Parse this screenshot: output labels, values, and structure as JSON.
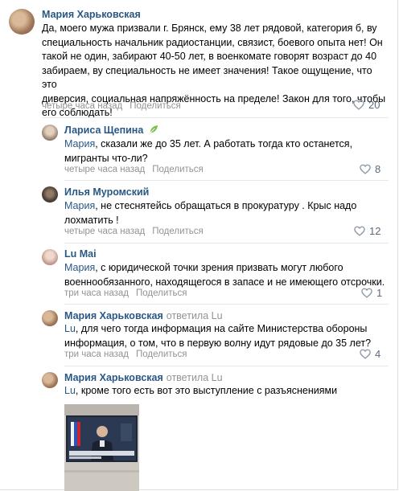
{
  "comments": [
    {
      "author": "Мария Харьковская",
      "text_lines": [
        "Да, моего мужа призвали г. Брянск, ему 38 лет рядовой, категория б, ву",
        "специальность начальник радиостанции, связист, боевого опыта нет! Он",
        "такой не один, забирают 40-50 лет, в военкомате говорят возраст до 40",
        "забираем, ву специальность не имеет значения! Такое ощущение, что это",
        "диверсия, социальная напряжённость на пределе! Закон для того, чтобы",
        "его соблюдать!"
      ],
      "time": "четыре часа назад",
      "share": "Поделиться",
      "likes": "20"
    },
    {
      "author": "Лариса Щепина",
      "badge_icon": "leaf-icon",
      "addressee": "Мария",
      "text_lines": [
        ", сказали же до 35 лет. А работать тогда кто останется,",
        "мигранты что-ли?"
      ],
      "time": "четыре часа назад",
      "share": "Поделиться",
      "likes": "8"
    },
    {
      "author": "Илья Муромский",
      "addressee": "Мария",
      "text_lines": [
        ", не стеснятейсь обращаться в прокуратуру . Крыс надо",
        "лохматить !"
      ],
      "time": "четыре часа назад",
      "share": "Поделиться",
      "likes": "12"
    },
    {
      "author": "Lu Mai",
      "addressee": "Мария",
      "text_lines": [
        ", с юридической точки зрения призвать могут любого",
        "военнообязанного, находящегося в запасе и не имеющего отсрочки."
      ],
      "time": "три часа назад",
      "share": "Поделиться",
      "likes": "1"
    },
    {
      "author": "Мария Харьковская",
      "reply_to": "ответила Lu",
      "addressee": "Lu",
      "text_lines": [
        ", для чего тогда информация на сайте Министерства обороны",
        "информация, о том, что в первую волну идут рядовые до 35 лет?"
      ],
      "time": "три часа назад",
      "share": "Поделиться",
      "likes": "4"
    },
    {
      "author": "Мария Харьковская",
      "reply_to": "ответила Lu",
      "addressee": "Lu",
      "text_lines": [
        ", кроме того есть вот это выступление с разъяснениями"
      ]
    }
  ],
  "colors": {
    "link": "#2a5885",
    "meta": "#939393",
    "likes": "#5b6b7e",
    "divider": "#e7e8ec"
  },
  "icons": [
    "heart-icon",
    "leaf-icon",
    "avatar"
  ]
}
